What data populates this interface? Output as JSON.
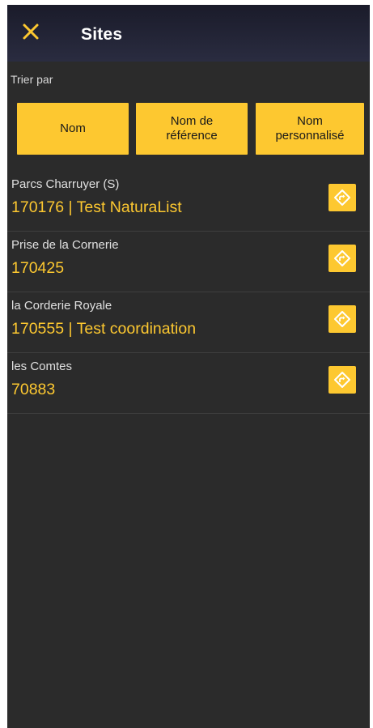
{
  "appbar": {
    "title": "Sites",
    "close_icon": "close-icon"
  },
  "sort": {
    "label": "Trier par",
    "options": [
      {
        "label": "Nom"
      },
      {
        "label": "Nom de\nréférence"
      },
      {
        "label": "Nom\npersonnalisé"
      }
    ]
  },
  "sites": [
    {
      "name": "Parcs Charruyer (S)",
      "code": "170176 | Test NaturaList",
      "icon": "directions-icon"
    },
    {
      "name": "Prise de la Cornerie",
      "code": "170425",
      "icon": "directions-icon"
    },
    {
      "name": "la Corderie Royale",
      "code": "170555 | Test coordination",
      "icon": "directions-icon"
    },
    {
      "name": "les Comtes",
      "code": "70883",
      "icon": "directions-icon"
    }
  ],
  "colors": {
    "accent": "#fdc830",
    "background": "#2b2b2b",
    "appbar": "#1e1f30"
  }
}
